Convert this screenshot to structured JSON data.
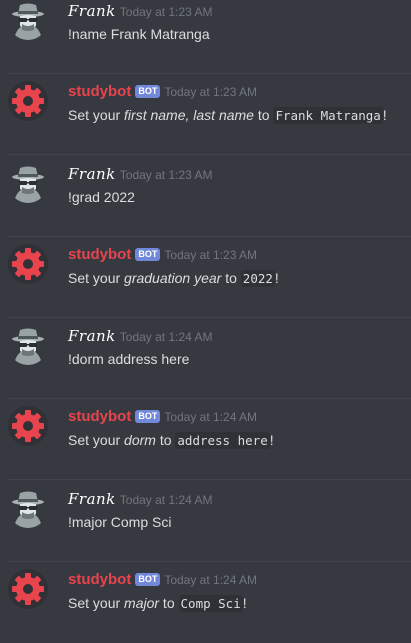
{
  "users": {
    "frank": "Frank",
    "bot": "studybot",
    "bot_badge": "BOT"
  },
  "messages": [
    {
      "author": "frank",
      "time": "Today at 1:23 AM",
      "text": "!name Frank Matranga"
    },
    {
      "author": "bot",
      "time": "Today at 1:23 AM",
      "pre": "Set your ",
      "field": "first name, last name",
      "mid": " to ",
      "code": "Frank Matranga",
      "post": "!"
    },
    {
      "author": "frank",
      "time": "Today at 1:23 AM",
      "text": "!grad 2022"
    },
    {
      "author": "bot",
      "time": "Today at 1:23 AM",
      "pre": "Set your ",
      "field": "graduation year",
      "mid": " to ",
      "code": "2022",
      "post": "!"
    },
    {
      "author": "frank",
      "time": "Today at 1:24 AM",
      "text": "!dorm address here"
    },
    {
      "author": "bot",
      "time": "Today at 1:24 AM",
      "pre": "Set your ",
      "field": "dorm",
      "mid": " to ",
      "code": "address here",
      "post": "!"
    },
    {
      "author": "frank",
      "time": "Today at 1:24 AM",
      "text": "!major Comp Sci"
    },
    {
      "author": "bot",
      "time": "Today at 1:24 AM",
      "pre": "Set your ",
      "field": "major",
      "mid": " to ",
      "code": "Comp Sci",
      "post": "!"
    }
  ],
  "icons": {
    "user_avatar": "spy-avatar-icon",
    "bot_avatar": "gear-avatar-icon"
  },
  "colors": {
    "background": "#36393f",
    "bot_name": "#e8444e",
    "bot_badge": "#7289da",
    "timestamp": "#72767d",
    "text": "#dcddde"
  }
}
